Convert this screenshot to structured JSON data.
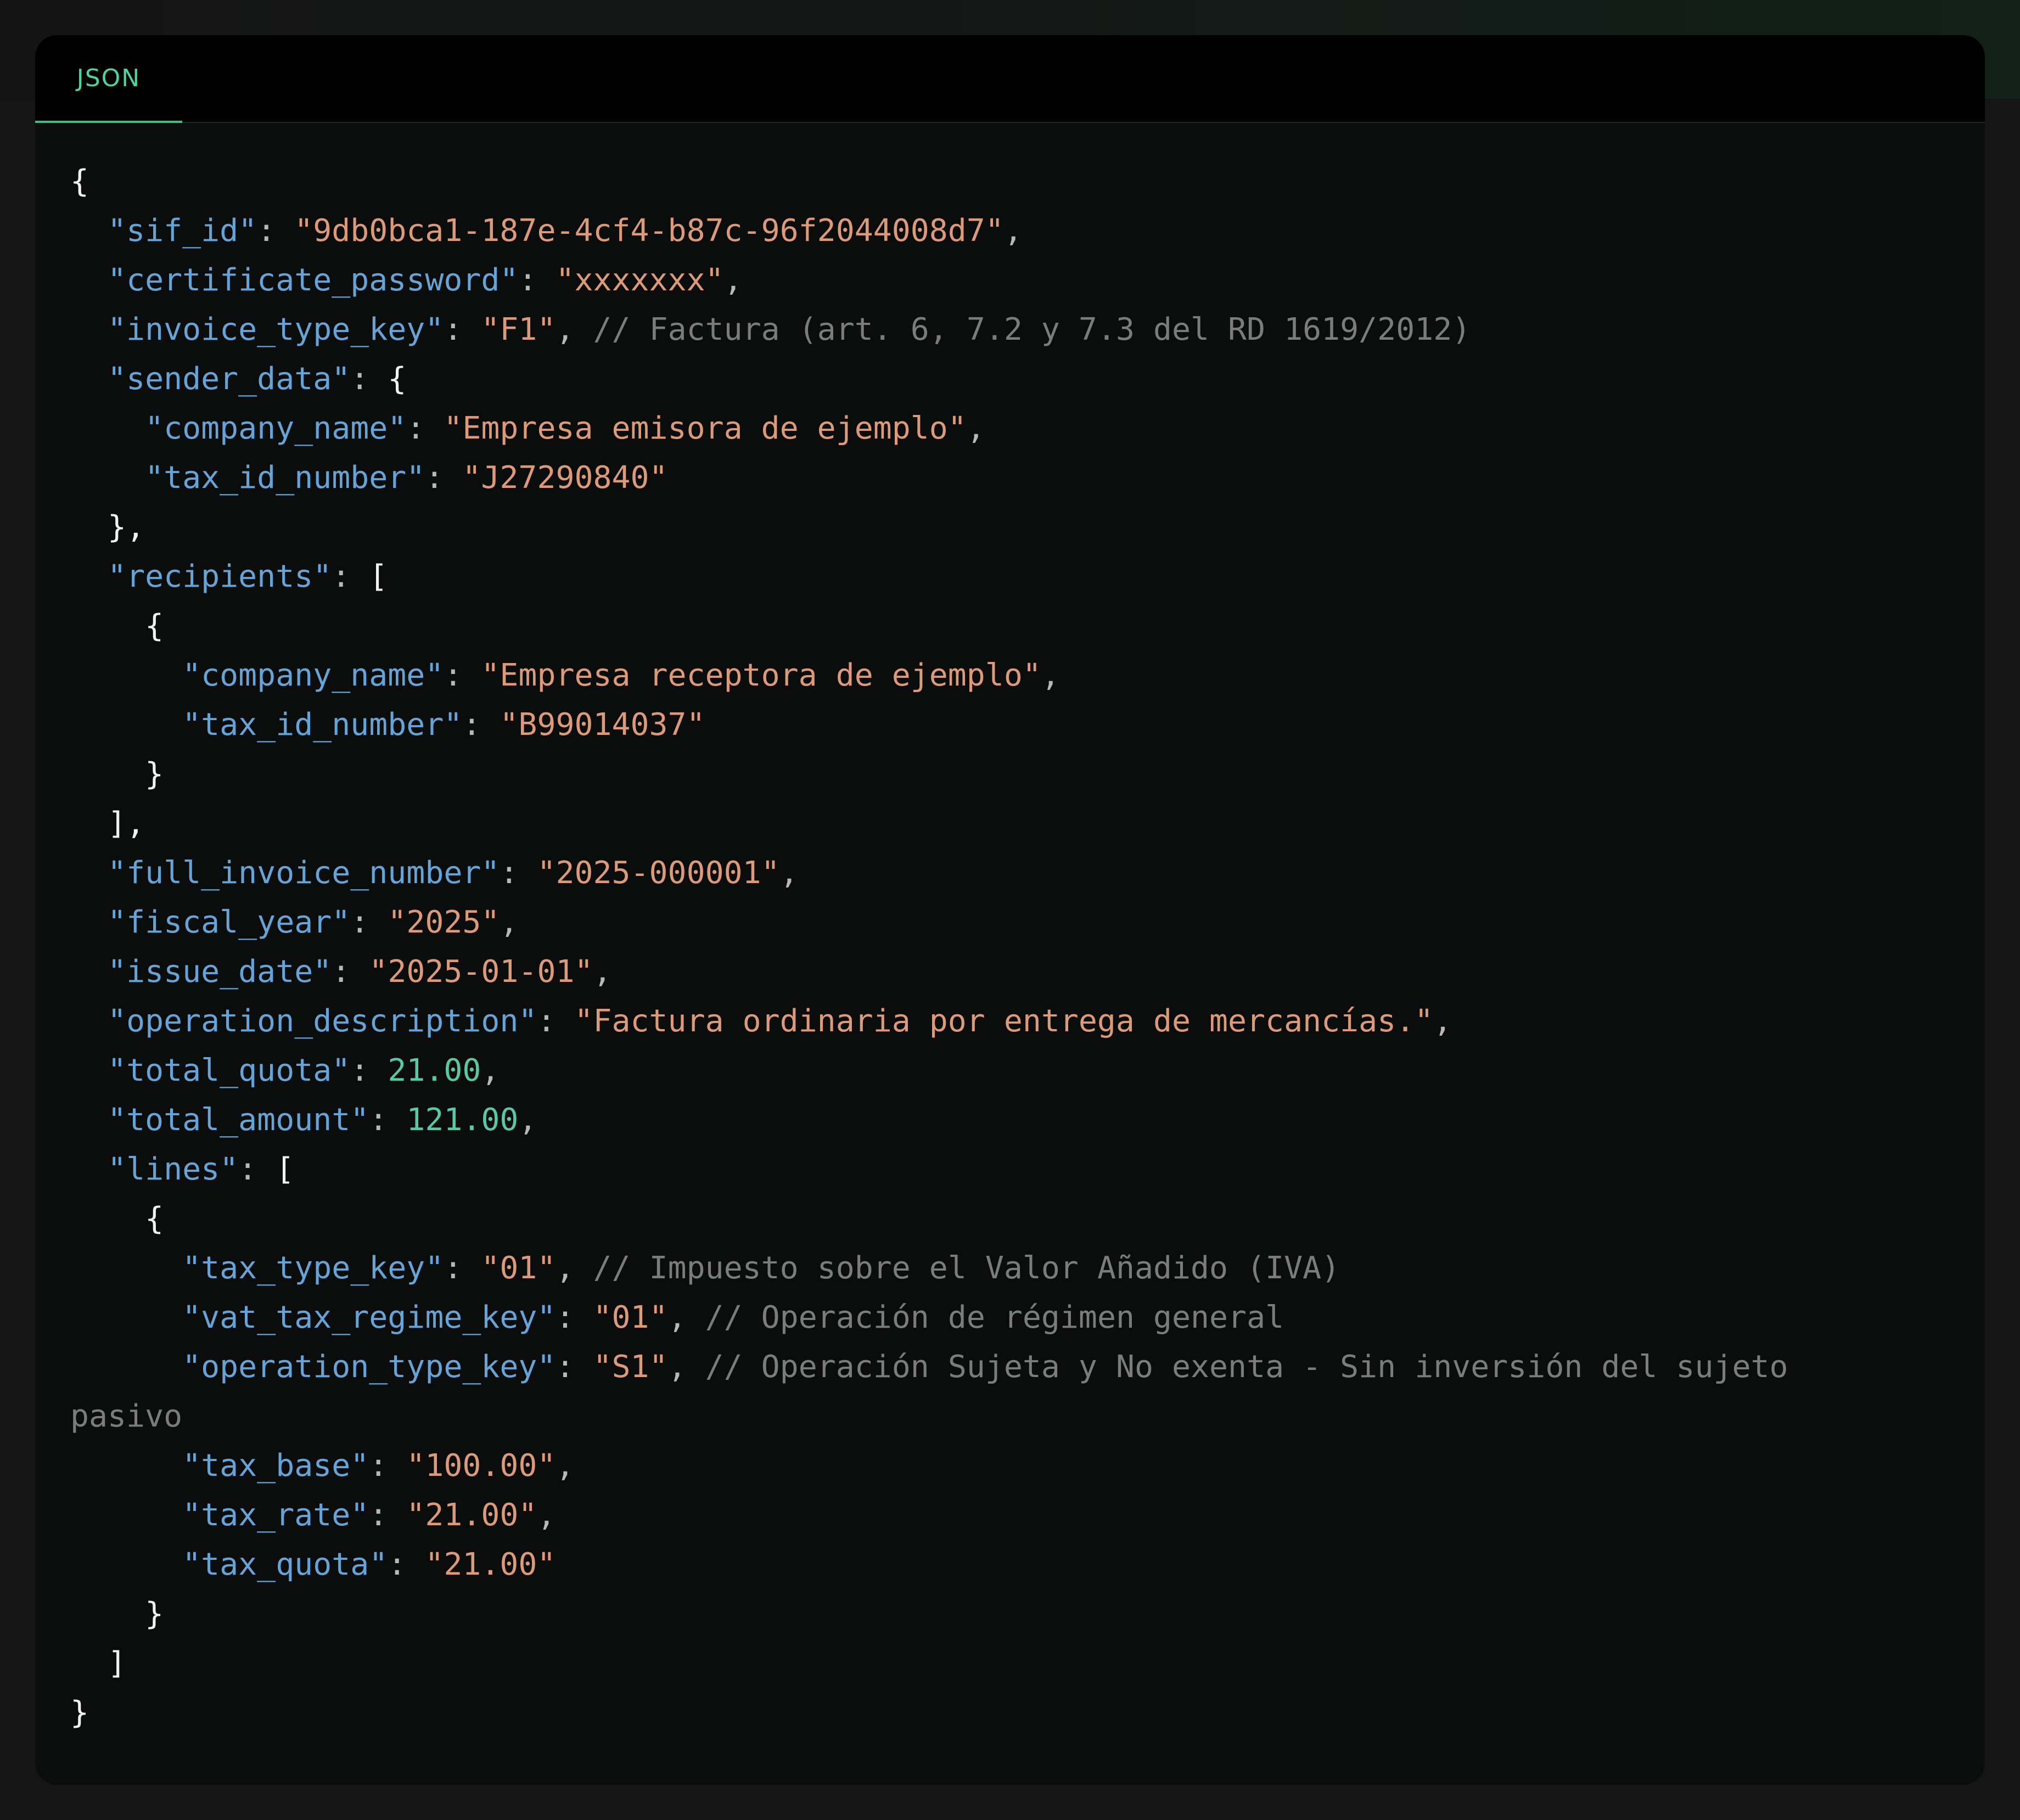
{
  "tab": {
    "label": "JSON"
  },
  "code": {
    "lines": [
      [
        {
          "t": "p",
          "v": "{"
        }
      ],
      [
        {
          "t": "p",
          "v": "  "
        },
        {
          "t": "k",
          "v": "\"sif_id\""
        },
        {
          "t": "pc",
          "v": ": "
        },
        {
          "t": "s",
          "v": "\"9db0bca1-187e-4cf4-b87c-96f2044008d7\""
        },
        {
          "t": "pc",
          "v": ","
        }
      ],
      [
        {
          "t": "p",
          "v": "  "
        },
        {
          "t": "k",
          "v": "\"certificate_password\""
        },
        {
          "t": "pc",
          "v": ": "
        },
        {
          "t": "s",
          "v": "\"xxxxxxx\""
        },
        {
          "t": "pc",
          "v": ","
        }
      ],
      [
        {
          "t": "p",
          "v": "  "
        },
        {
          "t": "k",
          "v": "\"invoice_type_key\""
        },
        {
          "t": "pc",
          "v": ": "
        },
        {
          "t": "s",
          "v": "\"F1\""
        },
        {
          "t": "pc",
          "v": ", "
        },
        {
          "t": "c",
          "v": "// Factura (art. 6, 7.2 y 7.3 del RD 1619/2012)"
        }
      ],
      [
        {
          "t": "p",
          "v": "  "
        },
        {
          "t": "k",
          "v": "\"sender_data\""
        },
        {
          "t": "pc",
          "v": ": "
        },
        {
          "t": "p",
          "v": "{"
        }
      ],
      [
        {
          "t": "p",
          "v": "    "
        },
        {
          "t": "k",
          "v": "\"company_name\""
        },
        {
          "t": "pc",
          "v": ": "
        },
        {
          "t": "s",
          "v": "\"Empresa emisora de ejemplo\""
        },
        {
          "t": "pc",
          "v": ","
        }
      ],
      [
        {
          "t": "p",
          "v": "    "
        },
        {
          "t": "k",
          "v": "\"tax_id_number\""
        },
        {
          "t": "pc",
          "v": ": "
        },
        {
          "t": "s",
          "v": "\"J27290840\""
        }
      ],
      [
        {
          "t": "p",
          "v": "  },"
        }
      ],
      [
        {
          "t": "p",
          "v": "  "
        },
        {
          "t": "k",
          "v": "\"recipients\""
        },
        {
          "t": "pc",
          "v": ": "
        },
        {
          "t": "p",
          "v": "["
        }
      ],
      [
        {
          "t": "p",
          "v": "    {"
        }
      ],
      [
        {
          "t": "p",
          "v": "      "
        },
        {
          "t": "k",
          "v": "\"company_name\""
        },
        {
          "t": "pc",
          "v": ": "
        },
        {
          "t": "s",
          "v": "\"Empresa receptora de ejemplo\""
        },
        {
          "t": "pc",
          "v": ","
        }
      ],
      [
        {
          "t": "p",
          "v": "      "
        },
        {
          "t": "k",
          "v": "\"tax_id_number\""
        },
        {
          "t": "pc",
          "v": ": "
        },
        {
          "t": "s",
          "v": "\"B99014037\""
        }
      ],
      [
        {
          "t": "p",
          "v": "    }"
        }
      ],
      [
        {
          "t": "p",
          "v": "  ],"
        }
      ],
      [
        {
          "t": "p",
          "v": "  "
        },
        {
          "t": "k",
          "v": "\"full_invoice_number\""
        },
        {
          "t": "pc",
          "v": ": "
        },
        {
          "t": "s",
          "v": "\"2025-000001\""
        },
        {
          "t": "pc",
          "v": ","
        }
      ],
      [
        {
          "t": "p",
          "v": "  "
        },
        {
          "t": "k",
          "v": "\"fiscal_year\""
        },
        {
          "t": "pc",
          "v": ": "
        },
        {
          "t": "s",
          "v": "\"2025\""
        },
        {
          "t": "pc",
          "v": ","
        }
      ],
      [
        {
          "t": "p",
          "v": "  "
        },
        {
          "t": "k",
          "v": "\"issue_date\""
        },
        {
          "t": "pc",
          "v": ": "
        },
        {
          "t": "s",
          "v": "\"2025-01-01\""
        },
        {
          "t": "pc",
          "v": ","
        }
      ],
      [
        {
          "t": "p",
          "v": "  "
        },
        {
          "t": "k",
          "v": "\"operation_description\""
        },
        {
          "t": "pc",
          "v": ": "
        },
        {
          "t": "s",
          "v": "\"Factura ordinaria por entrega de mercancías.\""
        },
        {
          "t": "pc",
          "v": ","
        }
      ],
      [
        {
          "t": "p",
          "v": "  "
        },
        {
          "t": "k",
          "v": "\"total_quota\""
        },
        {
          "t": "pc",
          "v": ": "
        },
        {
          "t": "n",
          "v": "21.00"
        },
        {
          "t": "pc",
          "v": ","
        }
      ],
      [
        {
          "t": "p",
          "v": "  "
        },
        {
          "t": "k",
          "v": "\"total_amount\""
        },
        {
          "t": "pc",
          "v": ": "
        },
        {
          "t": "n",
          "v": "121.00"
        },
        {
          "t": "pc",
          "v": ","
        }
      ],
      [
        {
          "t": "p",
          "v": "  "
        },
        {
          "t": "k",
          "v": "\"lines\""
        },
        {
          "t": "pc",
          "v": ": "
        },
        {
          "t": "p",
          "v": "["
        }
      ],
      [
        {
          "t": "p",
          "v": "    {"
        }
      ],
      [
        {
          "t": "p",
          "v": "      "
        },
        {
          "t": "k",
          "v": "\"tax_type_key\""
        },
        {
          "t": "pc",
          "v": ": "
        },
        {
          "t": "s",
          "v": "\"01\""
        },
        {
          "t": "pc",
          "v": ", "
        },
        {
          "t": "c",
          "v": "// Impuesto sobre el Valor Añadido (IVA)"
        }
      ],
      [
        {
          "t": "p",
          "v": "      "
        },
        {
          "t": "k",
          "v": "\"vat_tax_regime_key\""
        },
        {
          "t": "pc",
          "v": ": "
        },
        {
          "t": "s",
          "v": "\"01\""
        },
        {
          "t": "pc",
          "v": ", "
        },
        {
          "t": "c",
          "v": "// Operación de régimen general"
        }
      ],
      [
        {
          "t": "p",
          "v": "      "
        },
        {
          "t": "k",
          "v": "\"operation_type_key\""
        },
        {
          "t": "pc",
          "v": ": "
        },
        {
          "t": "s",
          "v": "\"S1\""
        },
        {
          "t": "pc",
          "v": ", "
        },
        {
          "t": "c",
          "v": "// Operación Sujeta y No exenta - Sin inversión del sujeto"
        }
      ],
      [
        {
          "t": "c",
          "v": "pasivo"
        }
      ],
      [
        {
          "t": "p",
          "v": "      "
        },
        {
          "t": "k",
          "v": "\"tax_base\""
        },
        {
          "t": "pc",
          "v": ": "
        },
        {
          "t": "s",
          "v": "\"100.00\""
        },
        {
          "t": "pc",
          "v": ","
        }
      ],
      [
        {
          "t": "p",
          "v": "      "
        },
        {
          "t": "k",
          "v": "\"tax_rate\""
        },
        {
          "t": "pc",
          "v": ": "
        },
        {
          "t": "s",
          "v": "\"21.00\""
        },
        {
          "t": "pc",
          "v": ","
        }
      ],
      [
        {
          "t": "p",
          "v": "      "
        },
        {
          "t": "k",
          "v": "\"tax_quota\""
        },
        {
          "t": "pc",
          "v": ": "
        },
        {
          "t": "s",
          "v": "\"21.00\""
        }
      ],
      [
        {
          "t": "p",
          "v": "    }"
        }
      ],
      [
        {
          "t": "p",
          "v": "  ]"
        }
      ],
      [
        {
          "t": "p",
          "v": "}"
        }
      ]
    ]
  },
  "colors": {
    "key": "#66a3d6",
    "string": "#dc9a79",
    "number": "#59c8a7",
    "comment": "#7c7c7c",
    "punctuation": "#f2f2f2",
    "tab_accent": "#4ed39a"
  }
}
